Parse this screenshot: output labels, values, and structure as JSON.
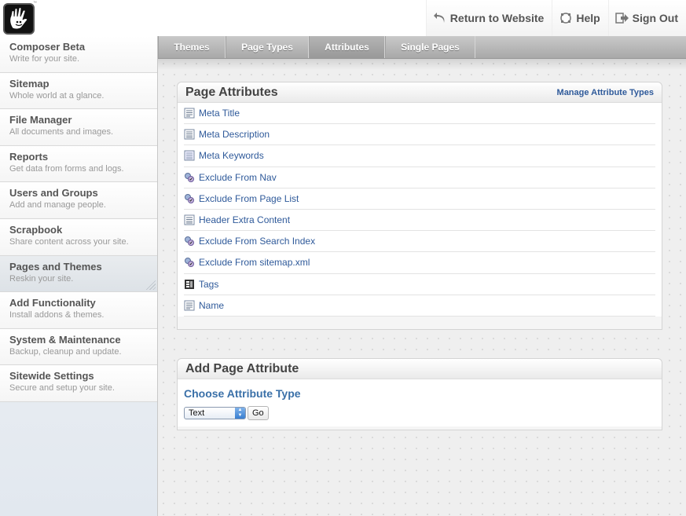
{
  "header": {
    "nav": [
      {
        "label": "Return to Website",
        "icon": "return-arrow-icon"
      },
      {
        "label": "Help",
        "icon": "help-icon"
      },
      {
        "label": "Sign Out",
        "icon": "sign-out-icon"
      }
    ]
  },
  "sidebar": {
    "items": [
      {
        "title": "Composer Beta",
        "desc": "Write for your site."
      },
      {
        "title": "Sitemap",
        "desc": "Whole world at a glance."
      },
      {
        "title": "File Manager",
        "desc": "All documents and images."
      },
      {
        "title": "Reports",
        "desc": "Get data from forms and logs."
      },
      {
        "title": "Users and Groups",
        "desc": "Add and manage people."
      },
      {
        "title": "Scrapbook",
        "desc": "Share content across your site."
      },
      {
        "title": "Pages and Themes",
        "desc": "Reskin your site."
      },
      {
        "title": "Add Functionality",
        "desc": "Install addons & themes."
      },
      {
        "title": "System & Maintenance",
        "desc": "Backup, cleanup and update."
      },
      {
        "title": "Sitewide Settings",
        "desc": "Secure and setup your site."
      }
    ]
  },
  "tabs": [
    "Themes",
    "Page Types",
    "Attributes",
    "Single Pages"
  ],
  "attributes_panel": {
    "title": "Page Attributes",
    "manage_link": "Manage Attribute Types",
    "items": [
      {
        "name": "Meta Title",
        "icon": "text-icon"
      },
      {
        "name": "Meta Description",
        "icon": "textarea-icon"
      },
      {
        "name": "Meta Keywords",
        "icon": "textarea-icon"
      },
      {
        "name": "Exclude From Nav",
        "icon": "checkbox-icon"
      },
      {
        "name": "Exclude From Page List",
        "icon": "checkbox-icon"
      },
      {
        "name": "Header Extra Content",
        "icon": "textarea-icon"
      },
      {
        "name": "Exclude From Search Index",
        "icon": "checkbox-icon"
      },
      {
        "name": "Exclude From sitemap.xml",
        "icon": "checkbox-icon"
      },
      {
        "name": "Tags",
        "icon": "select-icon"
      },
      {
        "name": "Name",
        "icon": "text-icon"
      }
    ]
  },
  "add_panel": {
    "title": "Add Page Attribute",
    "choose_label": "Choose Attribute Type",
    "select_value": "Text",
    "go_label": "Go"
  }
}
